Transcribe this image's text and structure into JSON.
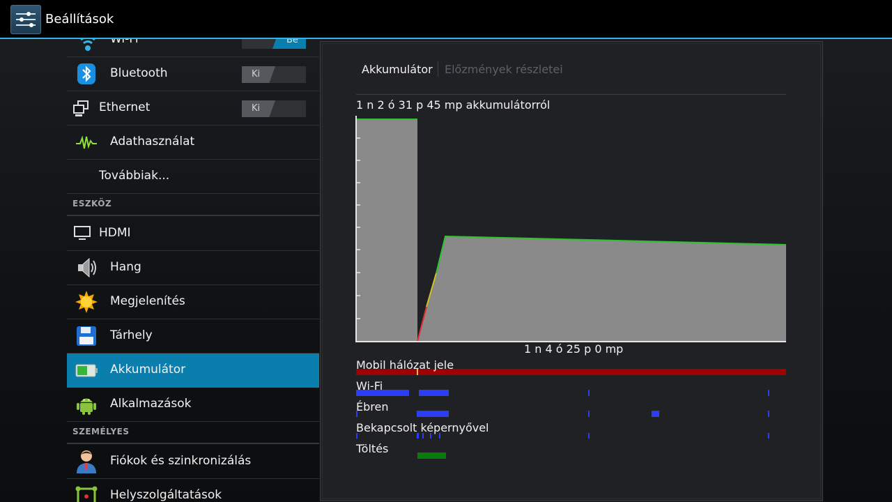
{
  "header": {
    "title": "Beállítások"
  },
  "sidebar": {
    "rows": [
      {
        "label": "Wi-Fi",
        "icon": "wifi-icon",
        "toggle": "Be"
      },
      {
        "label": "Bluetooth",
        "icon": "bluetooth-icon",
        "toggle": "Ki"
      },
      {
        "label": "Ethernet",
        "icon": "ethernet-icon",
        "toggle": "Ki"
      },
      {
        "label": "Adathasználat",
        "icon": "data-usage-icon"
      },
      {
        "label": "Továbbiak..."
      }
    ],
    "section_device": "ESZKÖZ",
    "device_rows": [
      {
        "label": "HDMI",
        "icon": "monitor-icon"
      },
      {
        "label": "Hang",
        "icon": "speaker-icon"
      },
      {
        "label": "Megjelenítés",
        "icon": "sun-icon"
      },
      {
        "label": "Tárhely",
        "icon": "floppy-icon"
      },
      {
        "label": "Akkumulátor",
        "icon": "battery-icon",
        "selected": true
      },
      {
        "label": "Alkalmazások",
        "icon": "android-icon"
      }
    ],
    "section_personal": "SZEMÉLYES",
    "personal_rows": [
      {
        "label": "Fiókok és szinkronizálás",
        "icon": "account-icon"
      },
      {
        "label": "Helyszolgáltatások",
        "icon": "location-icon"
      }
    ]
  },
  "battery": {
    "tab_main": "Akkumulátor",
    "tab_details": "Előzmények részletei",
    "on_battery_text": "1 n 2 ó 31 p 45 mp akkumulátorról",
    "elapsed_text": "1 n 4 ó 25 p 0 mp",
    "lanes": [
      {
        "label": "Mobil hálózat jele",
        "color": "#a00000"
      },
      {
        "label": "Wi-Fi",
        "color": "#2b3df5"
      },
      {
        "label": "Ébren",
        "color": "#2b3df5"
      },
      {
        "label": "Bekapcsolt képernyővel",
        "color": "#2b3df5"
      },
      {
        "label": "Töltés",
        "color": "#0a7a0a"
      }
    ]
  },
  "colors": {
    "accent": "#33b5e5",
    "selected_row": "#0a7fae",
    "graph_fill": "#8a8a8a",
    "graph_line": "#2fc42f",
    "low_battery": "#e03030"
  }
}
